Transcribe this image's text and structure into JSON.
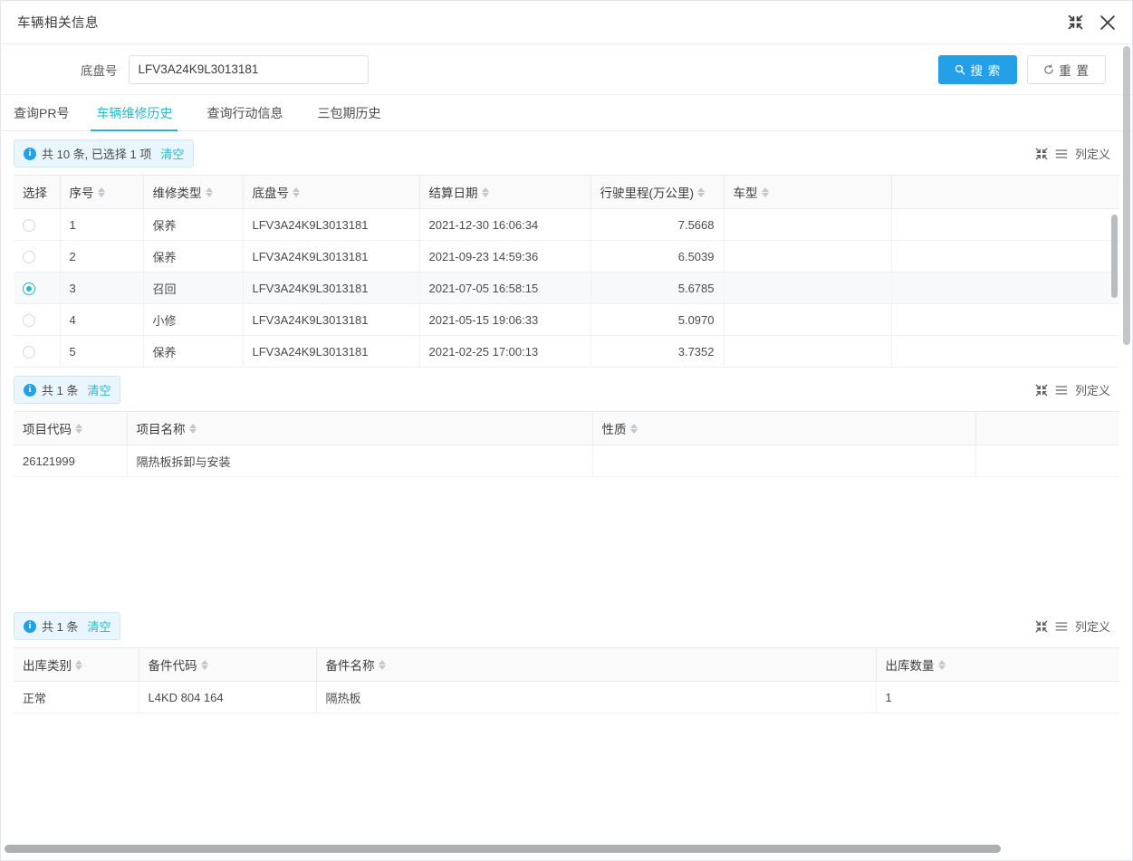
{
  "window": {
    "title": "车辆相关信息",
    "minimize_icon": "compress-arrows-icon",
    "close_icon": "close-icon"
  },
  "search": {
    "label": "底盘号",
    "value": "LFV3A24K9L3013181",
    "placeholder": "",
    "search_button": "搜 索",
    "search_icon": "search-icon",
    "reset_button": "重 置",
    "reset_icon": "refresh-icon"
  },
  "tabs": [
    {
      "label": "查询PR号",
      "active": false
    },
    {
      "label": "车辆维修历史",
      "active": true
    },
    {
      "label": "查询行动信息",
      "active": false
    },
    {
      "label": "三包期历史",
      "active": false
    }
  ],
  "panels": {
    "repair_history": {
      "info_text": "共 10 条, 已选择 1 项",
      "clear_label": "清空",
      "tools": {
        "expand_icon": "compress-arrows-icon",
        "list_icon": "list-icon",
        "column_def_label": "列定义"
      },
      "columns": [
        "选择",
        "序号",
        "维修类型",
        "底盘号",
        "结算日期",
        "行驶里程(万公里)",
        "车型"
      ],
      "rows": [
        {
          "selected": false,
          "seq": "1",
          "type": "保养",
          "chassis": "LFV3A24K9L3013181",
          "date": "2021-12-30 16:06:34",
          "mileage": "7.5668",
          "model": ""
        },
        {
          "selected": false,
          "seq": "2",
          "type": "保养",
          "chassis": "LFV3A24K9L3013181",
          "date": "2021-09-23 14:59:36",
          "mileage": "6.5039",
          "model": ""
        },
        {
          "selected": true,
          "seq": "3",
          "type": "召回",
          "chassis": "LFV3A24K9L3013181",
          "date": "2021-07-05 16:58:15",
          "mileage": "5.6785",
          "model": ""
        },
        {
          "selected": false,
          "seq": "4",
          "type": "小修",
          "chassis": "LFV3A24K9L3013181",
          "date": "2021-05-15 19:06:33",
          "mileage": "5.0970",
          "model": ""
        },
        {
          "selected": false,
          "seq": "5",
          "type": "保养",
          "chassis": "LFV3A24K9L3013181",
          "date": "2021-02-25 17:00:13",
          "mileage": "3.7352",
          "model": ""
        }
      ]
    },
    "items": {
      "info_text": "共 1 条",
      "clear_label": "清空",
      "tools": {
        "expand_icon": "compress-arrows-icon",
        "list_icon": "list-icon",
        "column_def_label": "列定义"
      },
      "columns": [
        "项目代码",
        "项目名称",
        "性质"
      ],
      "rows": [
        {
          "code": "26121999",
          "name": "隔热板拆卸与安装",
          "nature": ""
        }
      ]
    },
    "parts": {
      "info_text": "共 1 条",
      "clear_label": "清空",
      "tools": {
        "expand_icon": "compress-arrows-icon",
        "list_icon": "list-icon",
        "column_def_label": "列定义"
      },
      "columns": [
        "出库类别",
        "备件代码",
        "备件名称",
        "出库数量"
      ],
      "rows": [
        {
          "category": "正常",
          "part_code": "L4KD 804 164",
          "part_name": "隔热板",
          "qty": "1"
        }
      ]
    }
  },
  "colors": {
    "accent": "#24a0e8",
    "active_tab": "#2bb8c4",
    "info_bg": "#eaf6fd"
  }
}
